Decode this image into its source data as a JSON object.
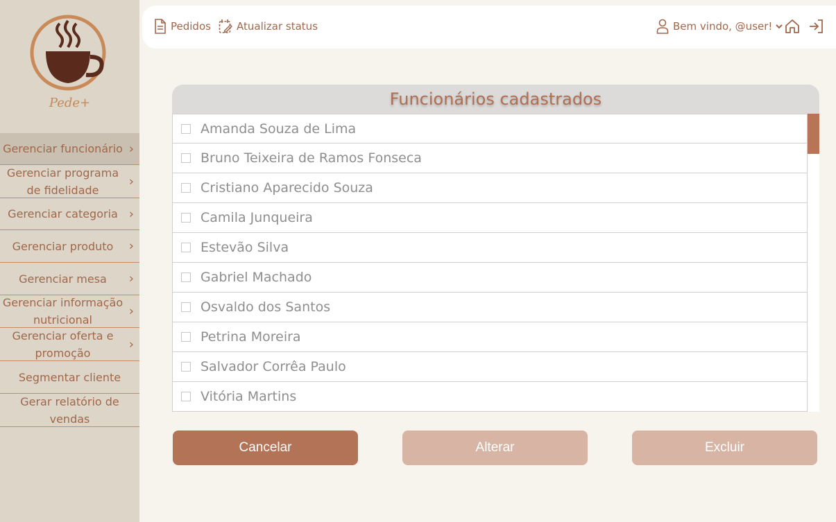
{
  "app": {
    "logo_text": "Pede+"
  },
  "sidebar": {
    "items": [
      {
        "label": "Gerenciar funcionário",
        "active": true,
        "chevron": true
      },
      {
        "label": "Gerenciar programa de fidelidade",
        "line1": "Gerenciar programa",
        "line2": "de fidelidade",
        "chevron": true
      },
      {
        "label": "Gerenciar categoria",
        "chevron": true
      },
      {
        "label": "Gerenciar produto",
        "chevron": true
      },
      {
        "label": "Gerenciar mesa",
        "chevron": true
      },
      {
        "label": "Gerenciar informação nutricional",
        "line1": "Gerenciar informação",
        "line2": "nutricional",
        "chevron": true
      },
      {
        "label": "Gerenciar oferta e promoção",
        "line1": "Gerenciar oferta e",
        "line2": "promoção",
        "chevron": true
      },
      {
        "label": "Segmentar cliente",
        "chevron": false
      },
      {
        "label": "Gerar relatório de vendas",
        "line1": "Gerar relatório de",
        "line2": "vendas",
        "chevron": false
      }
    ]
  },
  "topbar": {
    "orders_label": "Pedidos",
    "update_status_label": "Atualizar status",
    "welcome_label": "Bem vindo, @user!"
  },
  "panel": {
    "title": "Funcionários cadastrados",
    "employees": [
      "Amanda Souza de Lima",
      "Bruno Teixeira de Ramos Fonseca",
      "Cristiano Aparecido Souza",
      "Camila Junqueira",
      "Estevão Silva",
      "Gabriel Machado",
      "Osvaldo dos Santos",
      "Petrina Moreira",
      "Salvador Corrêa Paulo",
      "Vitória Martins"
    ]
  },
  "actions": {
    "cancel_label": "Cancelar",
    "edit_label": "Alterar",
    "delete_label": "Excluir"
  },
  "colors": {
    "accent": "#b27356",
    "accent_light": "#d7b4a3",
    "sidebar_bg": "#dcd5c8",
    "page_bg": "#f7f4ee"
  },
  "icons": [
    "coffee-cup-logo",
    "document-icon",
    "calendar-edit-icon",
    "user-icon",
    "chevron-down-icon",
    "home-icon",
    "logout-icon",
    "chevron-right-icon"
  ]
}
